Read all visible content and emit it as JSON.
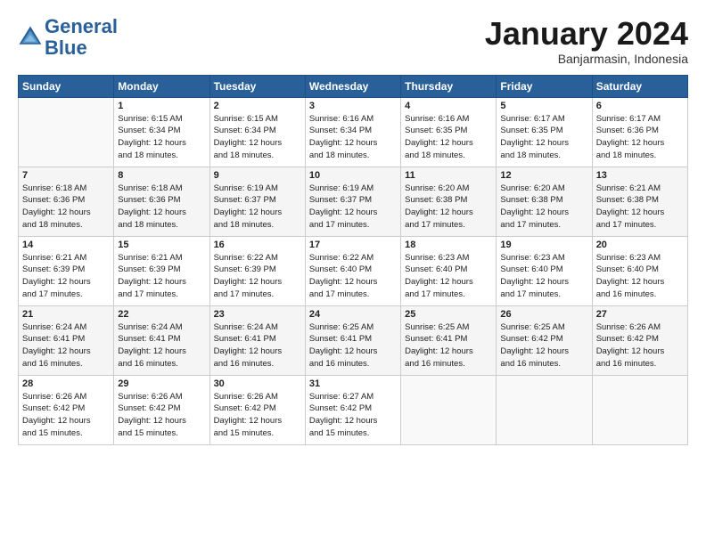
{
  "logo": {
    "line1": "General",
    "line2": "Blue"
  },
  "title": "January 2024",
  "subtitle": "Banjarmasin, Indonesia",
  "days_header": [
    "Sunday",
    "Monday",
    "Tuesday",
    "Wednesday",
    "Thursday",
    "Friday",
    "Saturday"
  ],
  "weeks": [
    [
      {
        "day": "",
        "info": ""
      },
      {
        "day": "1",
        "info": "Sunrise: 6:15 AM\nSunset: 6:34 PM\nDaylight: 12 hours\nand 18 minutes."
      },
      {
        "day": "2",
        "info": "Sunrise: 6:15 AM\nSunset: 6:34 PM\nDaylight: 12 hours\nand 18 minutes."
      },
      {
        "day": "3",
        "info": "Sunrise: 6:16 AM\nSunset: 6:34 PM\nDaylight: 12 hours\nand 18 minutes."
      },
      {
        "day": "4",
        "info": "Sunrise: 6:16 AM\nSunset: 6:35 PM\nDaylight: 12 hours\nand 18 minutes."
      },
      {
        "day": "5",
        "info": "Sunrise: 6:17 AM\nSunset: 6:35 PM\nDaylight: 12 hours\nand 18 minutes."
      },
      {
        "day": "6",
        "info": "Sunrise: 6:17 AM\nSunset: 6:36 PM\nDaylight: 12 hours\nand 18 minutes."
      }
    ],
    [
      {
        "day": "7",
        "info": "Sunrise: 6:18 AM\nSunset: 6:36 PM\nDaylight: 12 hours\nand 18 minutes."
      },
      {
        "day": "8",
        "info": "Sunrise: 6:18 AM\nSunset: 6:36 PM\nDaylight: 12 hours\nand 18 minutes."
      },
      {
        "day": "9",
        "info": "Sunrise: 6:19 AM\nSunset: 6:37 PM\nDaylight: 12 hours\nand 18 minutes."
      },
      {
        "day": "10",
        "info": "Sunrise: 6:19 AM\nSunset: 6:37 PM\nDaylight: 12 hours\nand 17 minutes."
      },
      {
        "day": "11",
        "info": "Sunrise: 6:20 AM\nSunset: 6:38 PM\nDaylight: 12 hours\nand 17 minutes."
      },
      {
        "day": "12",
        "info": "Sunrise: 6:20 AM\nSunset: 6:38 PM\nDaylight: 12 hours\nand 17 minutes."
      },
      {
        "day": "13",
        "info": "Sunrise: 6:21 AM\nSunset: 6:38 PM\nDaylight: 12 hours\nand 17 minutes."
      }
    ],
    [
      {
        "day": "14",
        "info": "Sunrise: 6:21 AM\nSunset: 6:39 PM\nDaylight: 12 hours\nand 17 minutes."
      },
      {
        "day": "15",
        "info": "Sunrise: 6:21 AM\nSunset: 6:39 PM\nDaylight: 12 hours\nand 17 minutes."
      },
      {
        "day": "16",
        "info": "Sunrise: 6:22 AM\nSunset: 6:39 PM\nDaylight: 12 hours\nand 17 minutes."
      },
      {
        "day": "17",
        "info": "Sunrise: 6:22 AM\nSunset: 6:40 PM\nDaylight: 12 hours\nand 17 minutes."
      },
      {
        "day": "18",
        "info": "Sunrise: 6:23 AM\nSunset: 6:40 PM\nDaylight: 12 hours\nand 17 minutes."
      },
      {
        "day": "19",
        "info": "Sunrise: 6:23 AM\nSunset: 6:40 PM\nDaylight: 12 hours\nand 17 minutes."
      },
      {
        "day": "20",
        "info": "Sunrise: 6:23 AM\nSunset: 6:40 PM\nDaylight: 12 hours\nand 16 minutes."
      }
    ],
    [
      {
        "day": "21",
        "info": "Sunrise: 6:24 AM\nSunset: 6:41 PM\nDaylight: 12 hours\nand 16 minutes."
      },
      {
        "day": "22",
        "info": "Sunrise: 6:24 AM\nSunset: 6:41 PM\nDaylight: 12 hours\nand 16 minutes."
      },
      {
        "day": "23",
        "info": "Sunrise: 6:24 AM\nSunset: 6:41 PM\nDaylight: 12 hours\nand 16 minutes."
      },
      {
        "day": "24",
        "info": "Sunrise: 6:25 AM\nSunset: 6:41 PM\nDaylight: 12 hours\nand 16 minutes."
      },
      {
        "day": "25",
        "info": "Sunrise: 6:25 AM\nSunset: 6:41 PM\nDaylight: 12 hours\nand 16 minutes."
      },
      {
        "day": "26",
        "info": "Sunrise: 6:25 AM\nSunset: 6:42 PM\nDaylight: 12 hours\nand 16 minutes."
      },
      {
        "day": "27",
        "info": "Sunrise: 6:26 AM\nSunset: 6:42 PM\nDaylight: 12 hours\nand 16 minutes."
      }
    ],
    [
      {
        "day": "28",
        "info": "Sunrise: 6:26 AM\nSunset: 6:42 PM\nDaylight: 12 hours\nand 15 minutes."
      },
      {
        "day": "29",
        "info": "Sunrise: 6:26 AM\nSunset: 6:42 PM\nDaylight: 12 hours\nand 15 minutes."
      },
      {
        "day": "30",
        "info": "Sunrise: 6:26 AM\nSunset: 6:42 PM\nDaylight: 12 hours\nand 15 minutes."
      },
      {
        "day": "31",
        "info": "Sunrise: 6:27 AM\nSunset: 6:42 PM\nDaylight: 12 hours\nand 15 minutes."
      },
      {
        "day": "",
        "info": ""
      },
      {
        "day": "",
        "info": ""
      },
      {
        "day": "",
        "info": ""
      }
    ]
  ]
}
